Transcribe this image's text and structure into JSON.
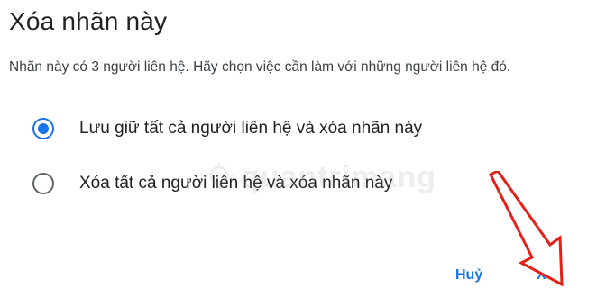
{
  "dialog": {
    "title": "Xóa nhãn này",
    "description": "Nhãn này có 3 người liên hệ. Hãy chọn việc cần làm với những người liên hệ đó.",
    "options": [
      {
        "label": "Lưu giữ tất cả người liên hệ và xóa nhãn này",
        "selected": true
      },
      {
        "label": "Xóa tất cả người liên hệ và xóa nhãn này",
        "selected": false
      }
    ],
    "buttons": {
      "cancel": "Huỷ",
      "delete": "Xóa"
    }
  },
  "watermark": {
    "text": "quantrimang",
    "icon": "lightbulb-logo-icon"
  },
  "overlay": {
    "arrow_icon": "red-arrow-icon",
    "arrow_color": "#e3211b"
  },
  "colors": {
    "accent": "#1a73e8",
    "text": "#202124",
    "secondary_text": "#3c4043"
  }
}
